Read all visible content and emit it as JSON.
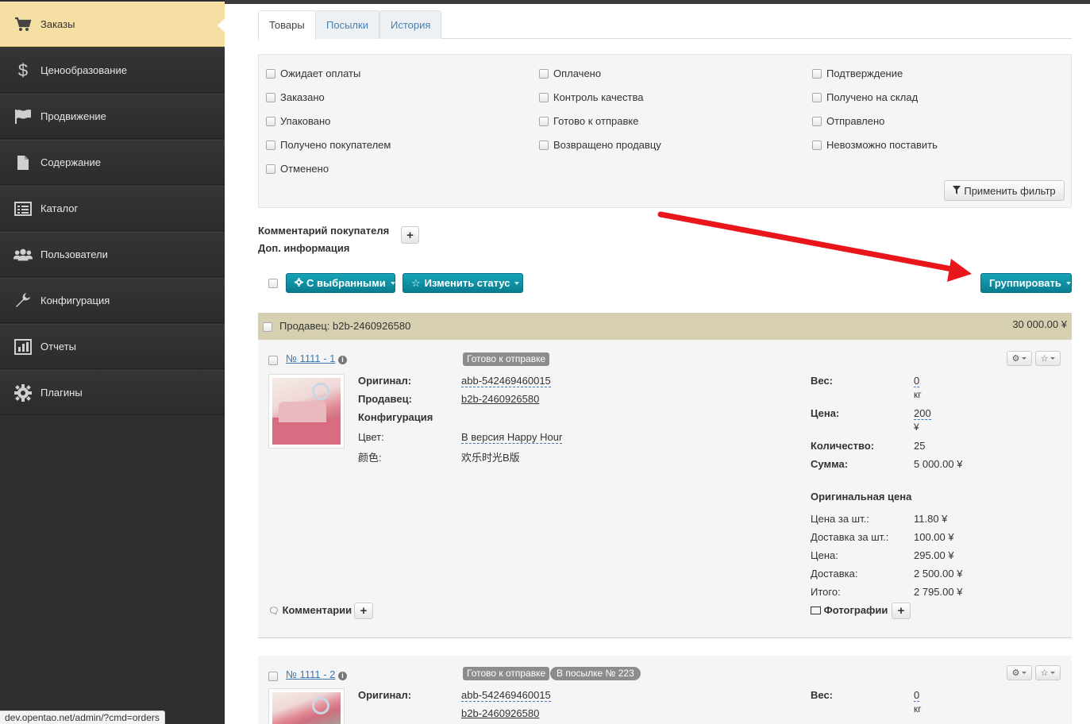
{
  "sidebar": {
    "items": [
      {
        "label": "Заказы",
        "icon": "cart-icon",
        "active": true
      },
      {
        "label": "Ценообразование",
        "icon": "dollar-icon"
      },
      {
        "label": "Продвижение",
        "icon": "flag-icon"
      },
      {
        "label": "Содержание",
        "icon": "document-icon"
      },
      {
        "label": "Каталог",
        "icon": "list-icon"
      },
      {
        "label": "Пользователи",
        "icon": "users-icon"
      },
      {
        "label": "Конфигурация",
        "icon": "wrench-icon"
      },
      {
        "label": "Отчеты",
        "icon": "bar-chart-icon"
      },
      {
        "label": "Плагины",
        "icon": "gear-icon"
      }
    ]
  },
  "tabs": [
    {
      "label": "Товары",
      "active": true
    },
    {
      "label": "Посылки"
    },
    {
      "label": "История"
    }
  ],
  "filter": {
    "statuses": [
      "Ожидает оплаты",
      "Оплачено",
      "Подтверждение",
      "Заказано",
      "Контроль качества",
      "Получено на склад",
      "Упаковано",
      "Готово к отправке",
      "Отправлено",
      "Получено покупателем",
      "Возвращено продавцу",
      "Невозможно поставить",
      "Отменено"
    ],
    "apply_label": "Применить фильтр"
  },
  "info": {
    "buyer_comment": "Комментарий покупателя",
    "extra_info": "Доп. информация"
  },
  "actions": {
    "with_selected": "С выбранными",
    "change_status": "Изменить статус",
    "group": "Группировать"
  },
  "group": {
    "title": "Продавец: b2b-2460926580",
    "total": "30 000.00 ¥"
  },
  "labels": {
    "original": "Оригинал:",
    "seller": "Продавец:",
    "configuration": "Конфигурация",
    "color": "Цвет:",
    "color_cn": "颜色:",
    "weight": "Вес:",
    "price": "Цена:",
    "quantity": "Количество:",
    "sum": "Сумма:",
    "original_price": "Оригинальная цена",
    "unit_price": "Цена за шт.:",
    "unit_delivery": "Доставка за шт.:",
    "price2": "Цена:",
    "delivery": "Доставка:",
    "total": "Итого:",
    "comments": "Комментарии",
    "photos": "Фотографии"
  },
  "orders": [
    {
      "number": "№ 1111 - 1",
      "status": "Готово к отправке",
      "original": "abb-542469460015",
      "seller": "b2b-2460926580",
      "color_value": "В версия Happy Hour",
      "color_cn_value": "欢乐时光B版",
      "weight": "0",
      "weight_unit": "кг",
      "price": "200",
      "price_unit": "¥",
      "quantity": "25",
      "sum": "5 000.00 ¥",
      "unit_price": "11.80 ¥",
      "unit_delivery": "100.00 ¥",
      "price_total": "295.00 ¥",
      "delivery_total": "2 500.00 ¥",
      "grand_total": "2 795.00 ¥"
    },
    {
      "number": "№ 1111 - 2",
      "status": "Готово к отправке",
      "parcel": "В посылке № 223",
      "original": "abb-542469460015",
      "seller": "b2b-2460926580",
      "weight": "0",
      "weight_unit": "кг"
    }
  ],
  "statusbar": "dev.opentao.net/admin/?cmd=orders",
  "colors": {
    "accent": "#0f8fa2",
    "active_sidebar": "#f6dfa3",
    "group_header": "#d6d0b1",
    "arrow": "#e8161b"
  }
}
